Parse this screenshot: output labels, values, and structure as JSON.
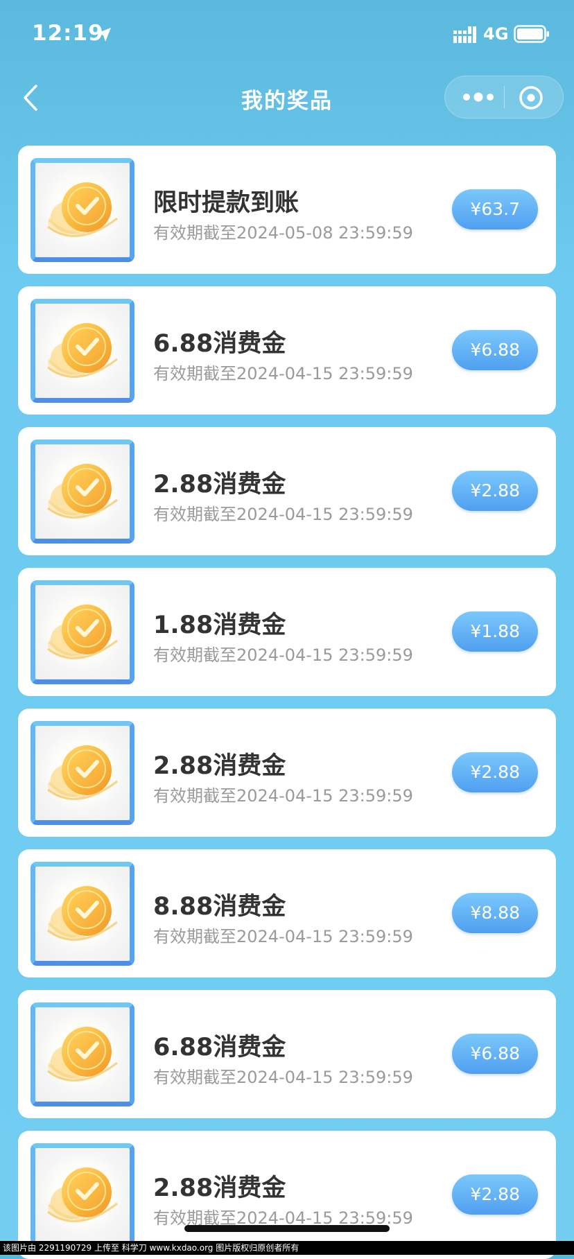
{
  "status_bar": {
    "time": "12:19",
    "network": "4G"
  },
  "nav": {
    "title": "我的奖品"
  },
  "prizes": [
    {
      "name": "限时提款到账",
      "expiry": "有效期截至2024-05-08 23:59:59",
      "amount": "¥63.7"
    },
    {
      "name": "6.88消费金",
      "expiry": "有效期截至2024-04-15 23:59:59",
      "amount": "¥6.88"
    },
    {
      "name": "2.88消费金",
      "expiry": "有效期截至2024-04-15 23:59:59",
      "amount": "¥2.88"
    },
    {
      "name": "1.88消费金",
      "expiry": "有效期截至2024-04-15 23:59:59",
      "amount": "¥1.88"
    },
    {
      "name": "2.88消费金",
      "expiry": "有效期截至2024-04-15 23:59:59",
      "amount": "¥2.88"
    },
    {
      "name": "8.88消费金",
      "expiry": "有效期截至2024-04-15 23:59:59",
      "amount": "¥8.88"
    },
    {
      "name": "6.88消费金",
      "expiry": "有效期截至2024-04-15 23:59:59",
      "amount": "¥6.88"
    },
    {
      "name": "2.88消费金",
      "expiry": "有效期截至2024-04-15 23:59:59",
      "amount": "¥2.88"
    }
  ],
  "watermark": "该图片由 2291190729 上传至 科学刀 www.kxdao.org 图片版权归原创者所有",
  "icons": {
    "prize": "gold-coin-check-icon",
    "back": "chevron-left-icon",
    "more": "more-dots-icon",
    "close": "target-circle-icon"
  }
}
